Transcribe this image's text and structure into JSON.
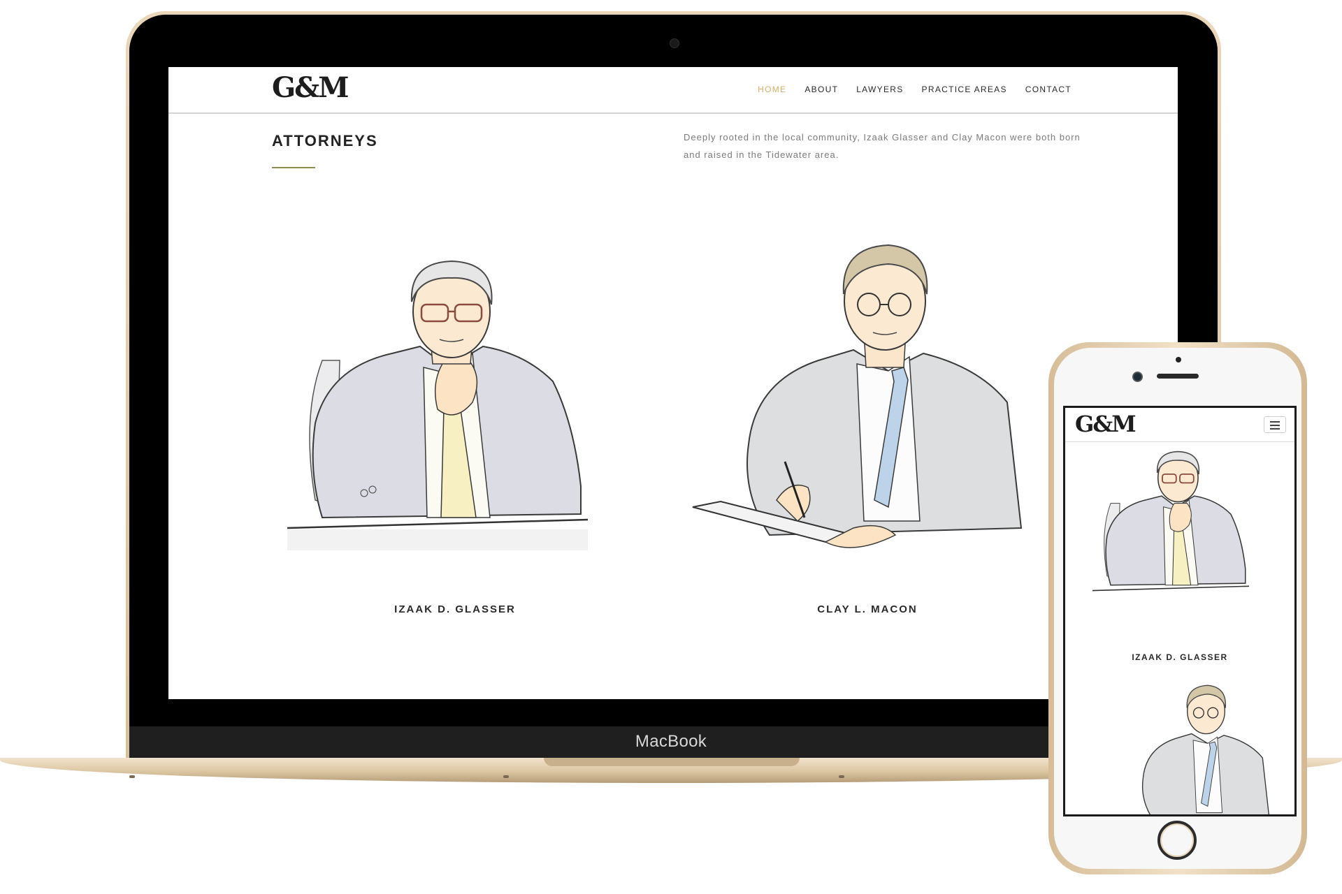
{
  "device": {
    "laptop_brand": "MacBook"
  },
  "site": {
    "logo": "G&M",
    "nav": [
      "HOME",
      "ABOUT",
      "LAWYERS",
      "PRACTICE AREAS",
      "CONTACT"
    ],
    "active_nav": "HOME",
    "accent_color": "#d4ad6a",
    "rule_color": "#8c8a55",
    "section_title": "ATTORNEYS",
    "intro": "Deeply rooted in the local community, Izaak Glasser and Clay Macon were both born and raised in the Tidewater area.",
    "attorneys": [
      {
        "name": "IZAAK D. GLASSER"
      },
      {
        "name": "CLAY L. MACON"
      }
    ]
  },
  "mobile": {
    "logo": "G&M",
    "featured_name": "IZAAK D. GLASSER"
  }
}
